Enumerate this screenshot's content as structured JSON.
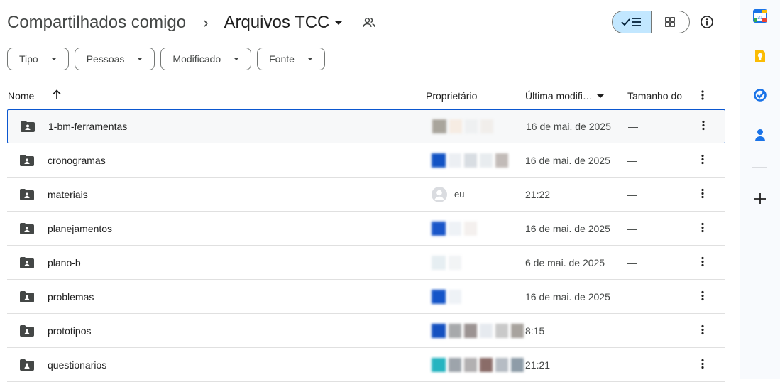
{
  "breadcrumb": {
    "root": "Compartilhados comigo",
    "separator": "›",
    "current": "Arquivos TCC"
  },
  "filters": [
    {
      "label": "Tipo"
    },
    {
      "label": "Pessoas"
    },
    {
      "label": "Modificado"
    },
    {
      "label": "Fonte"
    }
  ],
  "columns": {
    "name": "Nome",
    "owner": "Proprietário",
    "modified": "Última modifi…",
    "size": "Tamanho do"
  },
  "rows": [
    {
      "name": "1-bm-ferramentas",
      "date": "16 de mai. de 2025",
      "size": "—",
      "owner_blocks": [
        "#a9a59c",
        "#f6ece3",
        "#eef0f1",
        "#f1eeeb"
      ],
      "selected": true
    },
    {
      "name": "cronogramas",
      "date": "16 de mai. de 2025",
      "size": "—",
      "owner_blocks": [
        "#1152c4",
        "#eceff3",
        "#d8dde2",
        "#e8ecef",
        "#c2bbb8"
      ]
    },
    {
      "name": "materiais",
      "date": "21:22",
      "size": "—",
      "owner": "eu"
    },
    {
      "name": "planejamentos",
      "date": "16 de mai. de 2025",
      "size": "—",
      "owner_blocks": [
        "#1a56c9",
        "#eef2f6",
        "#f4f0ee"
      ]
    },
    {
      "name": "plano-b",
      "date": "6 de mai. de 2025",
      "size": "—",
      "owner_blocks": [
        "#e6eef2",
        "#f2f4f5"
      ]
    },
    {
      "name": "problemas",
      "date": "16 de mai. de 2025",
      "size": "—",
      "owner_blocks": [
        "#1454c8",
        "#eef2f6"
      ]
    },
    {
      "name": "prototipos",
      "date": "8:15",
      "size": "—",
      "owner_blocks": [
        "#1450c0",
        "#a7a9ab",
        "#9b9392",
        "#e6eaef",
        "#c9c9c9",
        "#a8a39e"
      ]
    },
    {
      "name": "questionarios",
      "date": "21:21",
      "size": "—",
      "owner_blocks": [
        "#26b4c0",
        "#9da4ab",
        "#b2b0b1",
        "#8a6c68",
        "#b6bcc4",
        "#8e9ca8"
      ]
    }
  ],
  "side_panel": [
    "calendar-icon",
    "keep-icon",
    "tasks-icon",
    "contacts-icon",
    "add-icon"
  ]
}
